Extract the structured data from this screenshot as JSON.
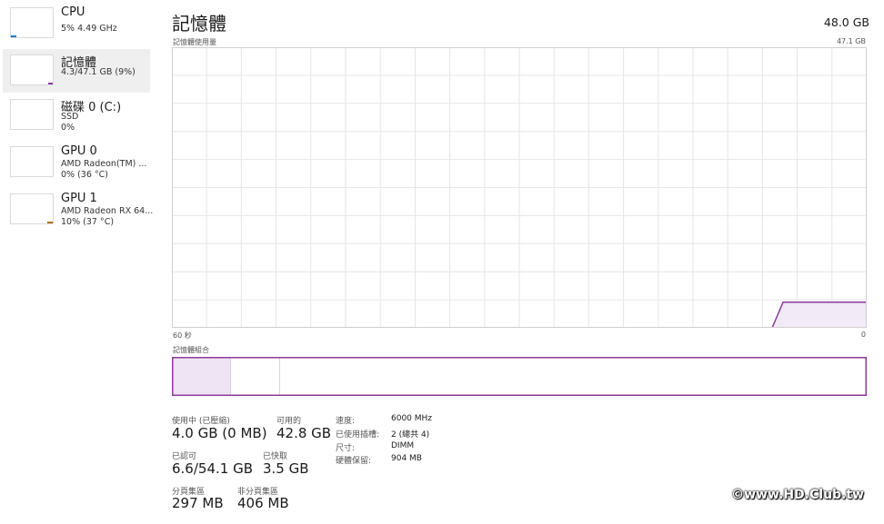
{
  "sidebar": {
    "items": [
      {
        "name": "CPU",
        "line1": "5% 4.49 GHz",
        "line2": "",
        "selected": false,
        "color": "#1f7acc"
      },
      {
        "name": "記憶體",
        "line1": "4.3/47.1 GB (9%)",
        "line2": "",
        "selected": true,
        "color": "#8b3a9e"
      },
      {
        "name": "磁碟 0 (C:)",
        "line1": "SSD",
        "line2": "0%",
        "selected": false,
        "color": "#4d9a2e"
      },
      {
        "name": "GPU 0",
        "line1": "AMD Radeon(TM) ...",
        "line2": "0% (36 °C)",
        "selected": false,
        "color": "#b36b00"
      },
      {
        "name": "GPU 1",
        "line1": "AMD Radeon RX 64...",
        "line2": "10% (37 °C)",
        "selected": false,
        "color": "#b36b00"
      }
    ]
  },
  "header": {
    "title": "記憶體",
    "total": "48.0 GB"
  },
  "usage_graph": {
    "label": "記憶體使用量",
    "max_label": "47.1 GB",
    "time_left": "60 秒",
    "time_right": "0",
    "line_color": "#8b3a9e",
    "fill_color": "#f2eaf6",
    "grid_color": "#e6e6e6"
  },
  "composition": {
    "label": "記憶體組合",
    "in_use_fraction": 0.085,
    "standby_fraction": 0.07
  },
  "stats": {
    "in_use_label": "使用中 (已壓縮)",
    "in_use_value": "4.0 GB (0 MB)",
    "available_label": "可用的",
    "available_value": "42.8 GB",
    "committed_label": "已認可",
    "committed_value": "6.6/54.1 GB",
    "cached_label": "已快取",
    "cached_value": "3.5 GB",
    "paged_label": "分頁集區",
    "paged_value": "297 MB",
    "nonpaged_label": "非分頁集區",
    "nonpaged_value": "406 MB"
  },
  "properties": [
    {
      "label": "速度:",
      "value": "6000 MHz"
    },
    {
      "label": "已使用插槽:",
      "value": "2 (總共 4)"
    },
    {
      "label": "尺寸:",
      "value": "DIMM"
    },
    {
      "label": "硬體保留:",
      "value": "904 MB"
    }
  ],
  "watermark": "©www.HD.Club.tw"
}
